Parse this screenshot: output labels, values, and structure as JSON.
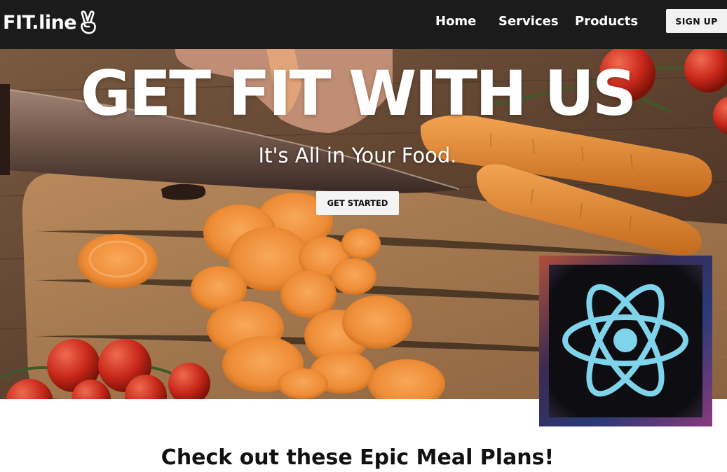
{
  "navbar": {
    "logo_text": "FIT.line",
    "logo_icon": "peace-hand-icon",
    "links": [
      {
        "label": "Home"
      },
      {
        "label": "Services"
      },
      {
        "label": "Products"
      }
    ],
    "signup_label": "SIGN UP"
  },
  "hero": {
    "title": "GET FIT WITH US",
    "subtitle": "It's All in Your Food.",
    "cta_label": "GET STARTED",
    "background": "kitchen-cutting-board-carrots-photo"
  },
  "badge": {
    "icon": "react-logo-icon",
    "accent": "#7fd3ea"
  },
  "section": {
    "title": "Check out these Epic Meal Plans!"
  },
  "colors": {
    "navbar_bg": "#1b1b1b",
    "button_bg": "#f2f2f2",
    "text_light": "#ffffff"
  }
}
